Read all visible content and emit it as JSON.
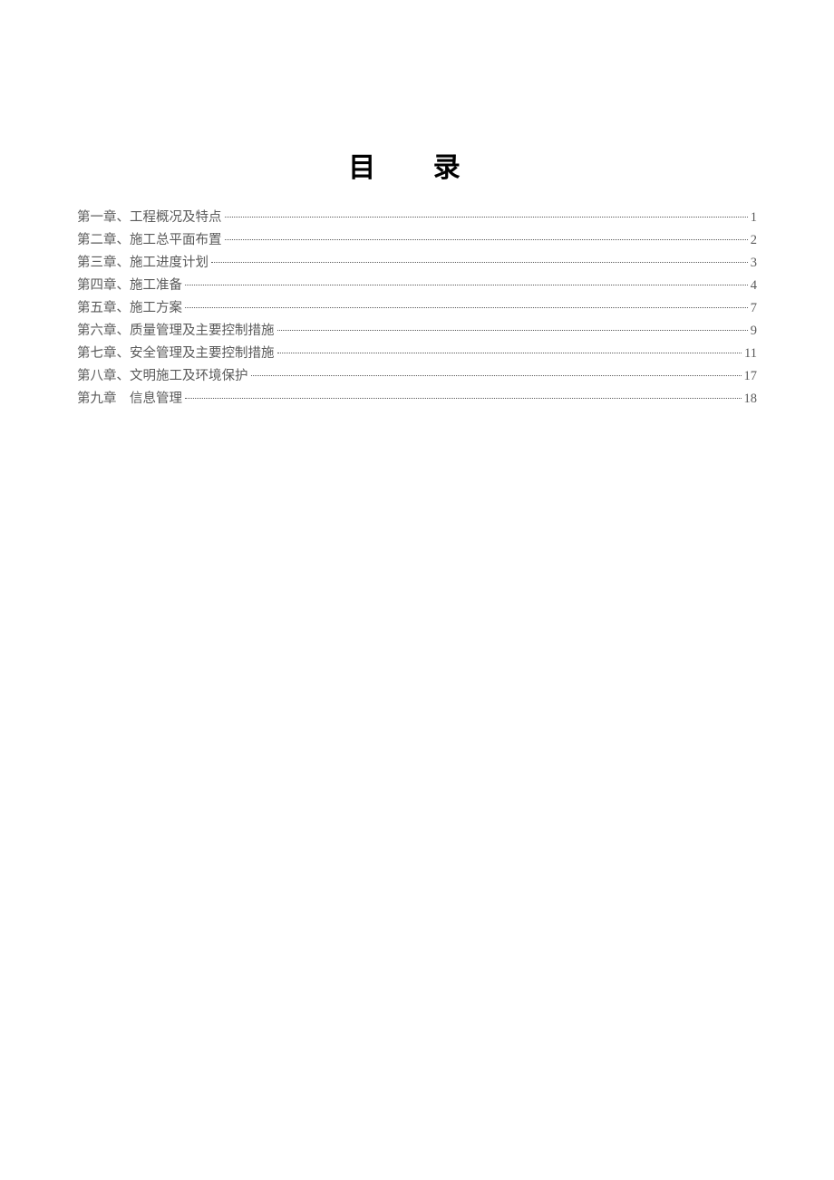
{
  "title": "目 录",
  "toc": {
    "entries": [
      {
        "label": "第一章、工程概况及特点",
        "page": "1"
      },
      {
        "label": "第二章、施工总平面布置",
        "page": "2"
      },
      {
        "label": "第三章、施工进度计划",
        "page": "3"
      },
      {
        "label": "第四章、施工准备",
        "page": "4"
      },
      {
        "label": "第五章、施工方案",
        "page": "7"
      },
      {
        "label": "第六章、质量管理及主要控制措施",
        "page": "9"
      },
      {
        "label": "第七章、安全管理及主要控制措施",
        "page": "11"
      },
      {
        "label": "第八章、文明施工及环境保护",
        "page": "17"
      },
      {
        "label": "第九章　信息管理",
        "page": "18"
      }
    ]
  }
}
